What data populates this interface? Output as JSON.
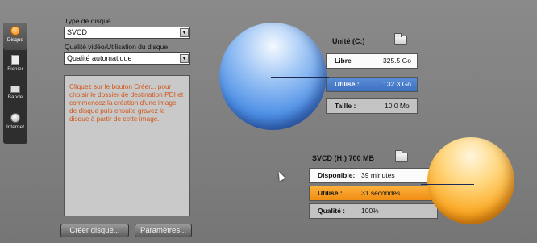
{
  "sidebar": {
    "tabs": [
      {
        "label": "Disque",
        "icon": "disc-icon",
        "active": true
      },
      {
        "label": "Fichier",
        "icon": "file-icon",
        "active": false
      },
      {
        "label": "Bande",
        "icon": "tape-icon",
        "active": false
      },
      {
        "label": "Internet",
        "icon": "globe-icon",
        "active": false
      }
    ]
  },
  "form": {
    "disc_type_label": "Type de disque",
    "disc_type_value": "SVCD",
    "quality_label": "Qualité vidéo/Utilisation du disque",
    "quality_value": "Qualité automatique",
    "info_text": "Cliquez sur le bouton Créer... pour choisir le dossier de destination PDI et commencez la création d'une image de disque puis ensuite gravez le disque à partir de cette image.",
    "create_button": "Créer disque...",
    "settings_button": "Paramètres..."
  },
  "drive": {
    "title": "Unité (C:)",
    "rows": [
      {
        "label": "Libre",
        "value": "325.5 Go"
      },
      {
        "label": "Utilisé :",
        "value": "132.3 Go"
      },
      {
        "label": "Taille :",
        "value": "10.0 Mo"
      }
    ]
  },
  "disc": {
    "title": "SVCD (H:) 700 MB",
    "rows": [
      {
        "label": "Disponible:",
        "value": "39 minutes"
      },
      {
        "label": "Utilisé :",
        "value": "31 secondes"
      },
      {
        "label": "Qualité :",
        "value": "100%"
      }
    ]
  },
  "colors": {
    "accent_orange": "#f08c12",
    "accent_blue": "#3d6fbf",
    "info_text": "#d2561a"
  }
}
